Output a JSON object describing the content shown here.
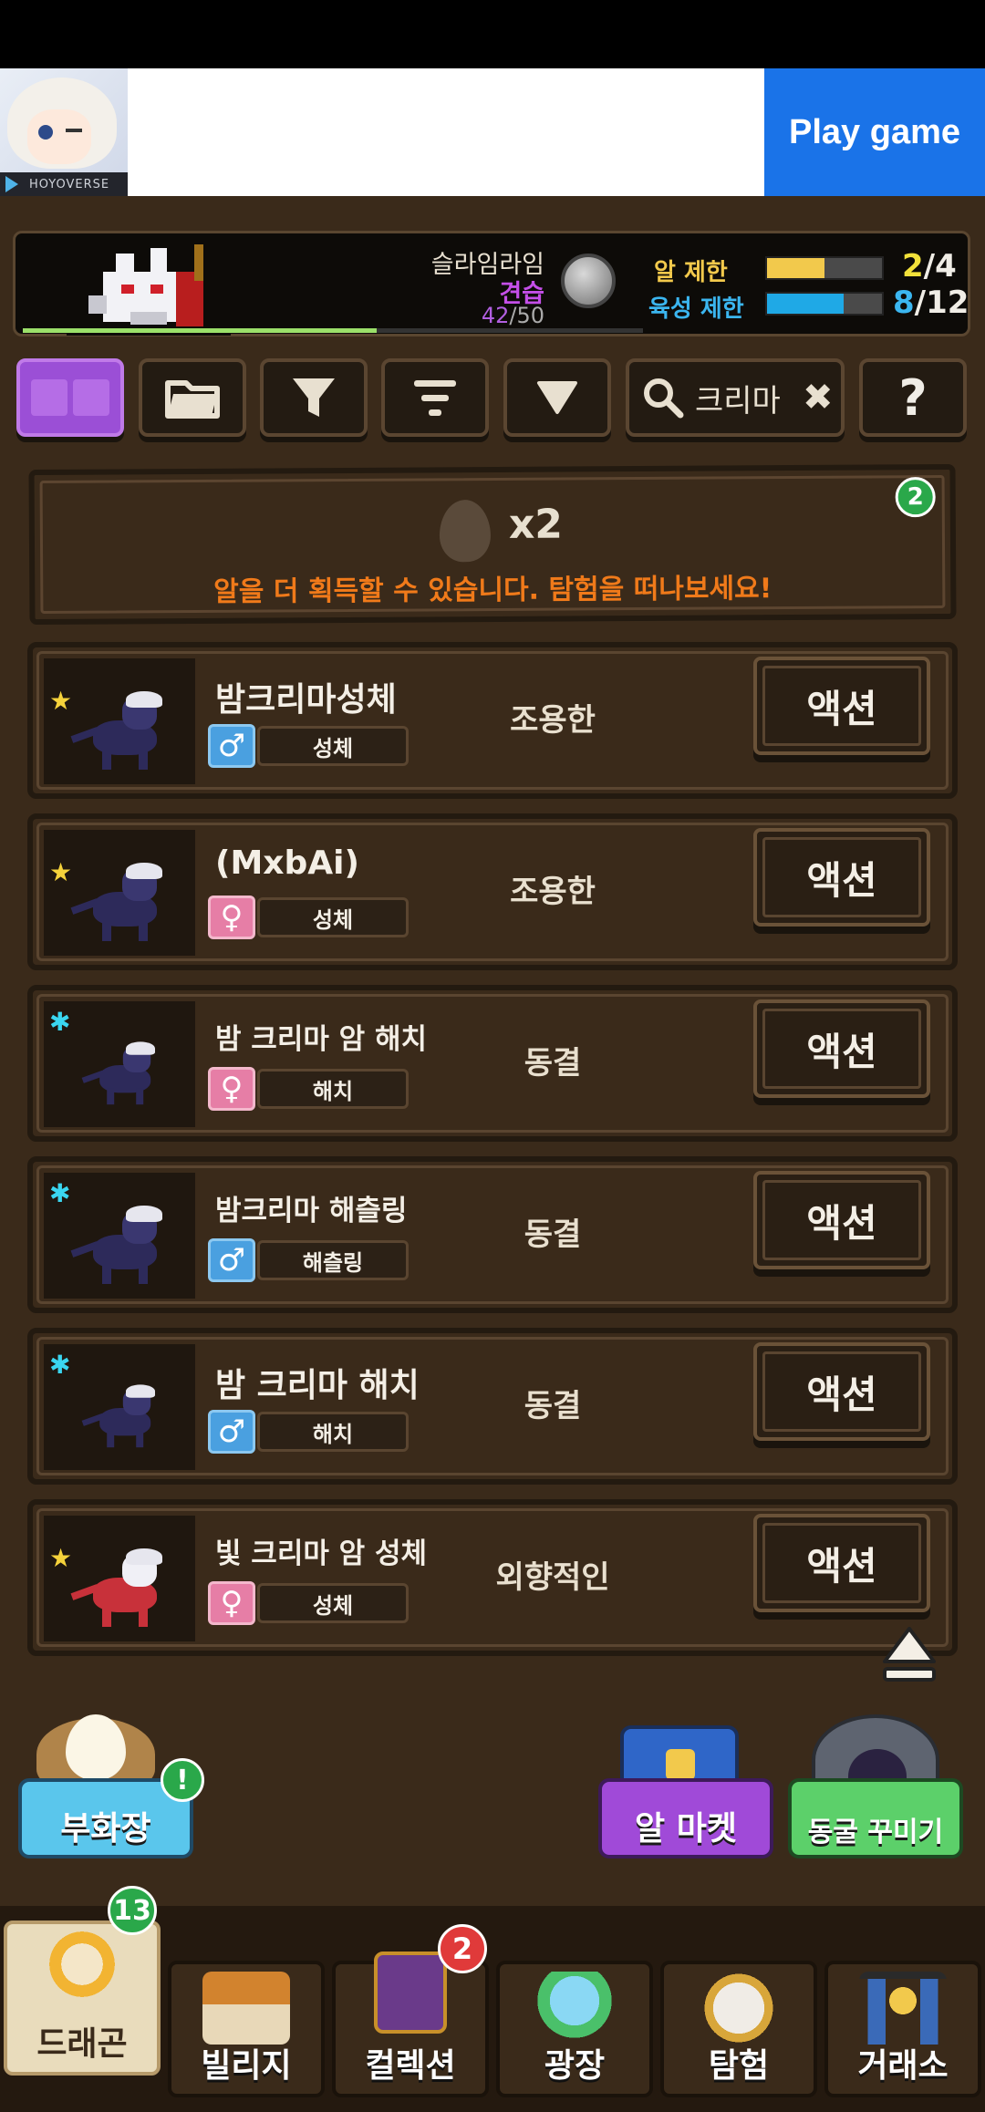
{
  "ad": {
    "brand": "HOYOVERSE",
    "cta_label": "Play game"
  },
  "player": {
    "name": "슬라임라임",
    "title": "견습",
    "level_current": "42",
    "level_separator": "/",
    "level_max": "50",
    "xp_progress": 0.57
  },
  "limits": {
    "egg_label": "알 제한",
    "egg_current": "2",
    "egg_max": "/4",
    "egg_fill": 0.5,
    "breed_label": "육성 제한",
    "breed_current": "8",
    "breed_max": "/12",
    "breed_fill": 0.67
  },
  "toolbar": {
    "search_value": "크리마",
    "help_label": "?"
  },
  "egg_banner": {
    "count": "x2",
    "message": "알을 더 획득할 수 있습니다. 탐험을 떠나보세요!",
    "badge": "2"
  },
  "dragons": [
    {
      "name": "밤크리마성체",
      "gender": "♂",
      "stage": "성체",
      "temperament": "조용한",
      "action": "액션"
    },
    {
      "name": "(MxbAi)",
      "gender": "♀",
      "stage": "성체",
      "temperament": "조용한",
      "action": "액션"
    },
    {
      "name": "밤 크리마 암 해치",
      "gender": "♀",
      "stage": "해치",
      "temperament": "동결",
      "action": "액션"
    },
    {
      "name": "밤크리마 해츨링",
      "gender": "♂",
      "stage": "해츨링",
      "temperament": "동결",
      "action": "액션"
    },
    {
      "name": "밤 크리마 해치",
      "gender": "♂",
      "stage": "해치",
      "temperament": "동결",
      "action": "액션"
    },
    {
      "name": "빛 크리마 암 성체",
      "gender": "♀",
      "stage": "성체",
      "temperament": "외향적인",
      "action": "액션"
    }
  ],
  "quick_buttons": {
    "hatchery": "부화장",
    "hatchery_badge": "!",
    "egg_market": "알 마켓",
    "cave_deco": "동굴 꾸미기"
  },
  "nav": {
    "dragon": "드래곤",
    "dragon_badge": "13",
    "village": "빌리지",
    "collection": "컬렉션",
    "collection_badge": "2",
    "plaza": "광장",
    "explore": "탐험",
    "exchange": "거래소"
  }
}
